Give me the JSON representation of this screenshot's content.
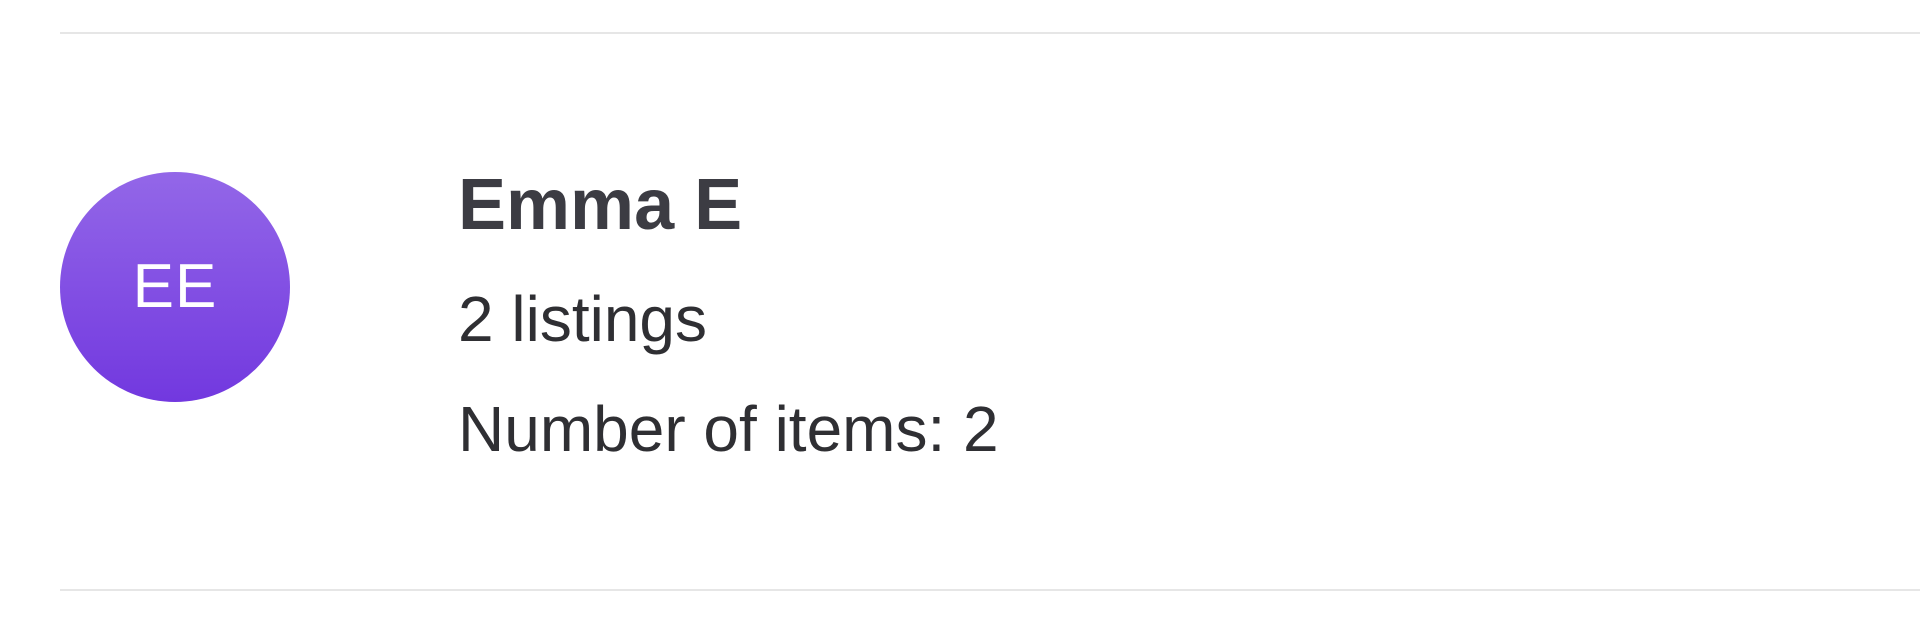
{
  "seller": {
    "initials": "EE",
    "name": "Emma E",
    "listings_text": "2 listings",
    "items_text": "Number of items: 2",
    "avatar_colors": [
      "#9367e8",
      "#7238df"
    ]
  }
}
